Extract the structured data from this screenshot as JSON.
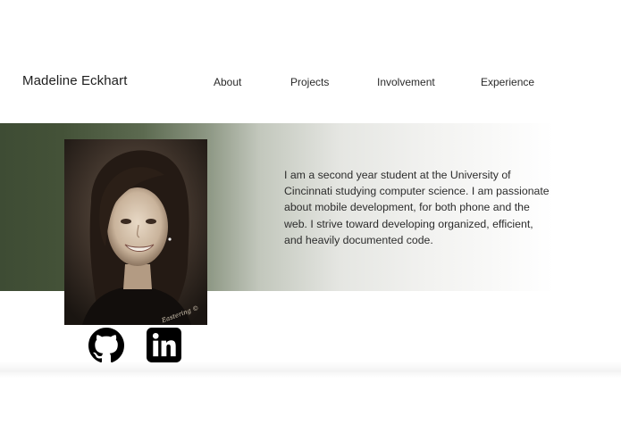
{
  "header": {
    "name": "Madeline Eckhart"
  },
  "nav": {
    "items": [
      {
        "label": "About"
      },
      {
        "label": "Projects"
      },
      {
        "label": "Involvement"
      },
      {
        "label": "Experience"
      }
    ]
  },
  "hero": {
    "photo_alt": "Portrait of Madeline Eckhart",
    "watermark": "Eastering ©",
    "bio": "I am a second year student at the University of Cincinnati studying computer science. I am passionate about mobile development, for both phone and the web. I strive toward developing organized, efficient, and heavily documented code.",
    "band_color": "#3e4c34"
  },
  "social": {
    "github_icon": "github-icon",
    "linkedin_icon": "linkedin-icon"
  }
}
